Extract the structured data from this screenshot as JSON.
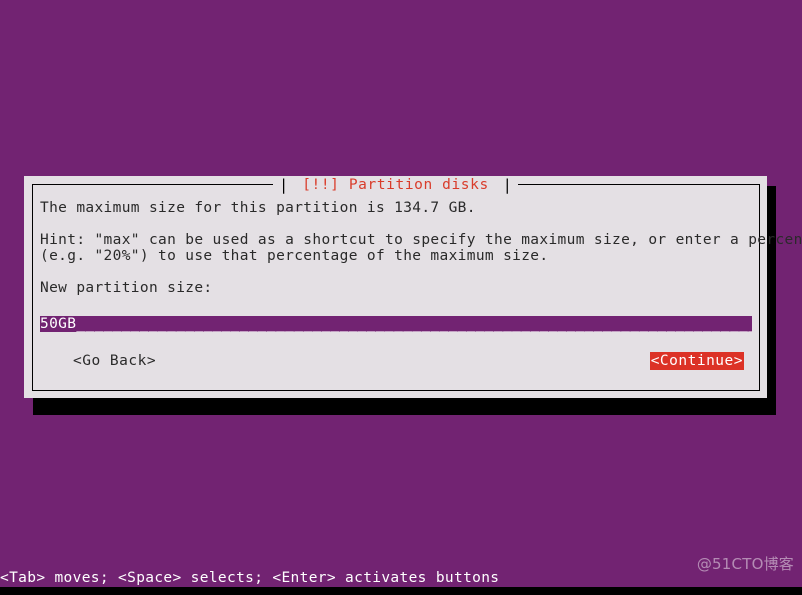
{
  "screen": {
    "background_color": "#722372",
    "shadow_color": "#000000"
  },
  "dialog": {
    "title": "[!!] Partition disks",
    "title_color": "#d93c2b",
    "title_separator": "|",
    "background_color": "#e4e0e4",
    "border_color": "#000000",
    "body": {
      "line1": "The maximum size for this partition is 134.7 GB.",
      "line2": "Hint: \"max\" can be used as a shortcut to specify the maximum size, or enter a percentage",
      "line3": "(e.g. \"20%\") to use that percentage of the maximum size.",
      "field_label": "New partition size:"
    },
    "input": {
      "value": "50GB",
      "fill": "_____________________________________________________________________________________",
      "background_color": "#722372",
      "text_color": "#ffffff"
    },
    "buttons": {
      "go_back": "<Go Back>",
      "continue": "<Continue>",
      "continue_selected": true,
      "continue_bg_color": "#dc3226",
      "continue_text_color": "#ffffff"
    }
  },
  "statusbar": {
    "text": "<Tab> moves; <Space> selects; <Enter> activates buttons",
    "text_color": "#ffffff"
  },
  "watermark": {
    "text": "@51CTO博客"
  }
}
